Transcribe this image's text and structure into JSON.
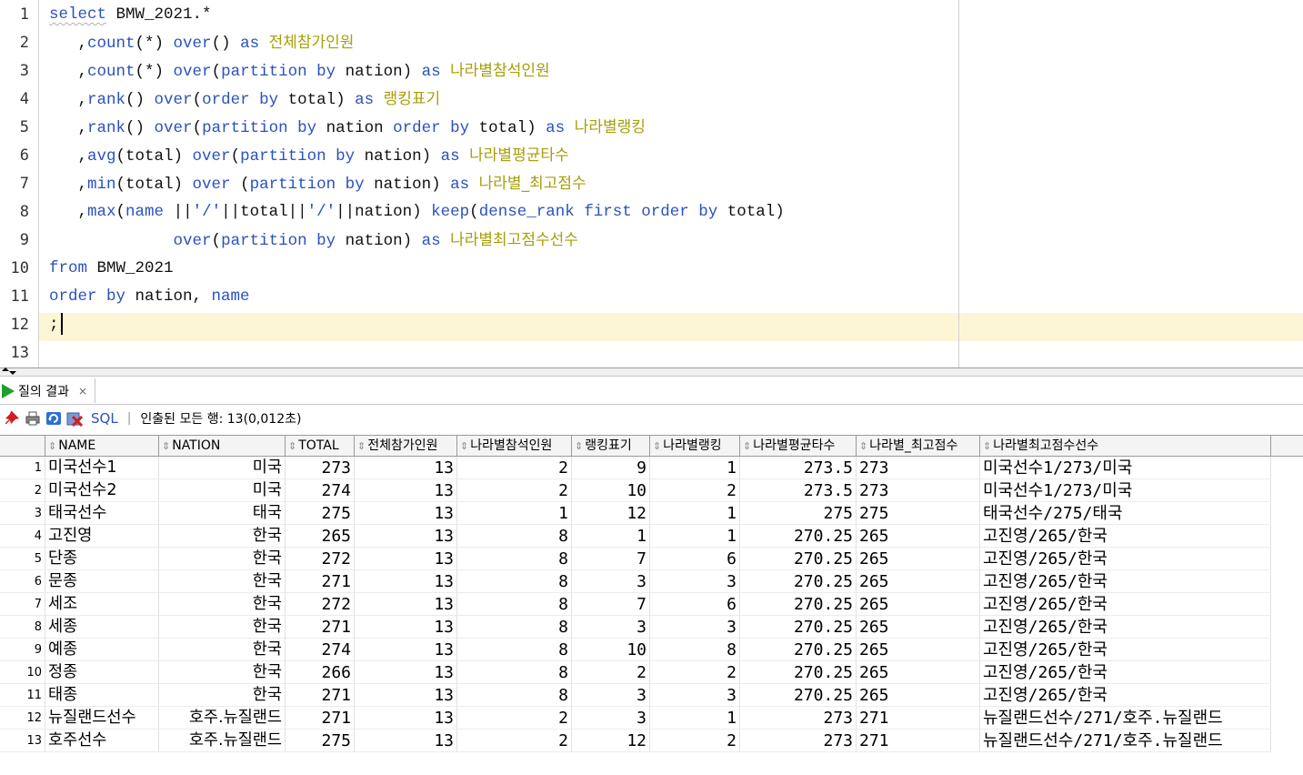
{
  "editor": {
    "line_numbers": [
      "1",
      "2",
      "3",
      "4",
      "5",
      "6",
      "7",
      "8",
      "9",
      "10",
      "11",
      "12",
      "13"
    ],
    "lines": [
      [
        {
          "t": "select",
          "k": "kw squig"
        },
        {
          "t": " BMW_2021.*",
          "k": ""
        }
      ],
      [
        {
          "t": "   ,",
          "k": ""
        },
        {
          "t": "count",
          "k": "kw"
        },
        {
          "t": "(*) ",
          "k": ""
        },
        {
          "t": "over",
          "k": "kw"
        },
        {
          "t": "() ",
          "k": ""
        },
        {
          "t": "as",
          "k": "kw"
        },
        {
          "t": " ",
          "k": ""
        },
        {
          "t": "전체참가인원",
          "k": "al"
        }
      ],
      [
        {
          "t": "   ,",
          "k": ""
        },
        {
          "t": "count",
          "k": "kw"
        },
        {
          "t": "(*) ",
          "k": ""
        },
        {
          "t": "over",
          "k": "kw"
        },
        {
          "t": "(",
          "k": ""
        },
        {
          "t": "partition by",
          "k": "kw"
        },
        {
          "t": " nation) ",
          "k": ""
        },
        {
          "t": "as",
          "k": "kw"
        },
        {
          "t": " ",
          "k": ""
        },
        {
          "t": "나라별참석인원",
          "k": "al"
        }
      ],
      [
        {
          "t": "   ,",
          "k": ""
        },
        {
          "t": "rank",
          "k": "kw"
        },
        {
          "t": "() ",
          "k": ""
        },
        {
          "t": "over",
          "k": "kw"
        },
        {
          "t": "(",
          "k": ""
        },
        {
          "t": "order by",
          "k": "kw"
        },
        {
          "t": " total) ",
          "k": ""
        },
        {
          "t": "as",
          "k": "kw"
        },
        {
          "t": " ",
          "k": ""
        },
        {
          "t": "랭킹표기",
          "k": "al"
        }
      ],
      [
        {
          "t": "   ,",
          "k": ""
        },
        {
          "t": "rank",
          "k": "kw"
        },
        {
          "t": "() ",
          "k": ""
        },
        {
          "t": "over",
          "k": "kw"
        },
        {
          "t": "(",
          "k": ""
        },
        {
          "t": "partition by",
          "k": "kw"
        },
        {
          "t": " nation ",
          "k": ""
        },
        {
          "t": "order by",
          "k": "kw"
        },
        {
          "t": " total) ",
          "k": ""
        },
        {
          "t": "as",
          "k": "kw"
        },
        {
          "t": " ",
          "k": ""
        },
        {
          "t": "나라별랭킹",
          "k": "al"
        }
      ],
      [
        {
          "t": "   ,",
          "k": ""
        },
        {
          "t": "avg",
          "k": "kw"
        },
        {
          "t": "(total) ",
          "k": ""
        },
        {
          "t": "over",
          "k": "kw"
        },
        {
          "t": "(",
          "k": ""
        },
        {
          "t": "partition by",
          "k": "kw"
        },
        {
          "t": " nation) ",
          "k": ""
        },
        {
          "t": "as",
          "k": "kw"
        },
        {
          "t": " ",
          "k": ""
        },
        {
          "t": "나라별평균타수",
          "k": "al"
        }
      ],
      [
        {
          "t": "   ,",
          "k": ""
        },
        {
          "t": "min",
          "k": "kw"
        },
        {
          "t": "(total) ",
          "k": ""
        },
        {
          "t": "over",
          "k": "kw"
        },
        {
          "t": " (",
          "k": ""
        },
        {
          "t": "partition by",
          "k": "kw"
        },
        {
          "t": " nation) ",
          "k": ""
        },
        {
          "t": "as",
          "k": "kw"
        },
        {
          "t": " ",
          "k": ""
        },
        {
          "t": "나라별_최고점수",
          "k": "al"
        }
      ],
      [
        {
          "t": "   ,",
          "k": ""
        },
        {
          "t": "max",
          "k": "kw"
        },
        {
          "t": "(",
          "k": ""
        },
        {
          "t": "name",
          "k": "kw"
        },
        {
          "t": " ||",
          "k": ""
        },
        {
          "t": "'/'",
          "k": "kw"
        },
        {
          "t": "||total||",
          "k": ""
        },
        {
          "t": "'/'",
          "k": "kw"
        },
        {
          "t": "||nation) ",
          "k": ""
        },
        {
          "t": "keep",
          "k": "kw"
        },
        {
          "t": "(",
          "k": ""
        },
        {
          "t": "dense_rank first order by",
          "k": "kw"
        },
        {
          "t": " total)",
          "k": ""
        }
      ],
      [
        {
          "t": "             ",
          "k": ""
        },
        {
          "t": "over",
          "k": "kw"
        },
        {
          "t": "(",
          "k": ""
        },
        {
          "t": "partition by",
          "k": "kw"
        },
        {
          "t": " nation) ",
          "k": ""
        },
        {
          "t": "as",
          "k": "kw"
        },
        {
          "t": " ",
          "k": ""
        },
        {
          "t": "나라별최고점수선수",
          "k": "al"
        }
      ],
      [
        {
          "t": "from",
          "k": "kw"
        },
        {
          "t": " BMW_2021",
          "k": ""
        }
      ],
      [
        {
          "t": "order by",
          "k": "kw"
        },
        {
          "t": " nation, ",
          "k": ""
        },
        {
          "t": "name",
          "k": "kw"
        }
      ],
      [
        {
          "t": ";",
          "k": ""
        }
      ],
      []
    ]
  },
  "result_tab": {
    "label": "질의 결과",
    "close": "×"
  },
  "toolbar": {
    "sql_label": "SQL",
    "separator": "|",
    "status": "인출된 모든 행: 13(0,012초)"
  },
  "grid": {
    "columns": [
      "NAME",
      "NATION",
      "TOTAL",
      "전체참가인원",
      "나라별참석인원",
      "랭킹표기",
      "나라별랭킹",
      "나라별평균타수",
      "나라별_최고점수",
      "나라별최고점수선수"
    ],
    "rows": [
      [
        "1",
        "미국선수1",
        "미국",
        "273",
        "13",
        "2",
        "9",
        "1",
        "273.5",
        "273",
        "미국선수1/273/미국"
      ],
      [
        "2",
        "미국선수2",
        "미국",
        "274",
        "13",
        "2",
        "10",
        "2",
        "273.5",
        "273",
        "미국선수1/273/미국"
      ],
      [
        "3",
        "태국선수",
        "태국",
        "275",
        "13",
        "1",
        "12",
        "1",
        "275",
        "275",
        "태국선수/275/태국"
      ],
      [
        "4",
        "고진영",
        "한국",
        "265",
        "13",
        "8",
        "1",
        "1",
        "270.25",
        "265",
        "고진영/265/한국"
      ],
      [
        "5",
        "단종",
        "한국",
        "272",
        "13",
        "8",
        "7",
        "6",
        "270.25",
        "265",
        "고진영/265/한국"
      ],
      [
        "6",
        "문종",
        "한국",
        "271",
        "13",
        "8",
        "3",
        "3",
        "270.25",
        "265",
        "고진영/265/한국"
      ],
      [
        "7",
        "세조",
        "한국",
        "272",
        "13",
        "8",
        "7",
        "6",
        "270.25",
        "265",
        "고진영/265/한국"
      ],
      [
        "8",
        "세종",
        "한국",
        "271",
        "13",
        "8",
        "3",
        "3",
        "270.25",
        "265",
        "고진영/265/한국"
      ],
      [
        "9",
        "예종",
        "한국",
        "274",
        "13",
        "8",
        "10",
        "8",
        "270.25",
        "265",
        "고진영/265/한국"
      ],
      [
        "10",
        "정종",
        "한국",
        "266",
        "13",
        "8",
        "2",
        "2",
        "270.25",
        "265",
        "고진영/265/한국"
      ],
      [
        "11",
        "태종",
        "한국",
        "271",
        "13",
        "8",
        "3",
        "3",
        "270.25",
        "265",
        "고진영/265/한국"
      ],
      [
        "12",
        "뉴질랜드선수",
        "호주.뉴질랜드",
        "271",
        "13",
        "2",
        "3",
        "1",
        "273",
        "271",
        "뉴질랜드선수/271/호주.뉴질랜드"
      ],
      [
        "13",
        "호주선수",
        "호주.뉴질랜드",
        "275",
        "13",
        "2",
        "12",
        "2",
        "273",
        "271",
        "뉴질랜드선수/271/호주.뉴질랜드"
      ]
    ]
  },
  "colors": {
    "keyword": "#2a52be",
    "alias": "#a6a00a",
    "current_line": "#fdf6d6",
    "run_icon": "#1e9e2b"
  }
}
